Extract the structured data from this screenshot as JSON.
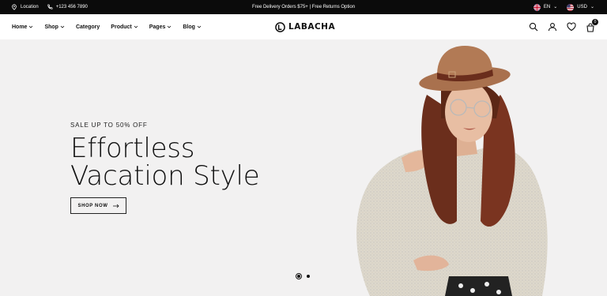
{
  "topbar": {
    "location": "Location",
    "phone": "+123 456 7890",
    "promo": "Free Delivery Orders $75+ | Free Returns Option",
    "language": "EN",
    "currency": "USD"
  },
  "nav": {
    "items": [
      {
        "label": "Home"
      },
      {
        "label": "Shop"
      },
      {
        "label": "Category"
      },
      {
        "label": "Product"
      },
      {
        "label": "Pages"
      },
      {
        "label": "Blog"
      }
    ]
  },
  "brand": {
    "name": "LABACHA"
  },
  "header": {
    "cart_count": "0"
  },
  "hero": {
    "eyebrow": "SALE UP TO 50% OFF",
    "headline_line1": "Effortless",
    "headline_line2": "Vacation Style",
    "cta": "SHOP NOW"
  },
  "icons": [
    "location-icon",
    "phone-icon",
    "uk-flag-icon",
    "us-flag-icon",
    "search-icon",
    "user-icon",
    "heart-icon",
    "cart-icon",
    "arrow-right-icon"
  ]
}
